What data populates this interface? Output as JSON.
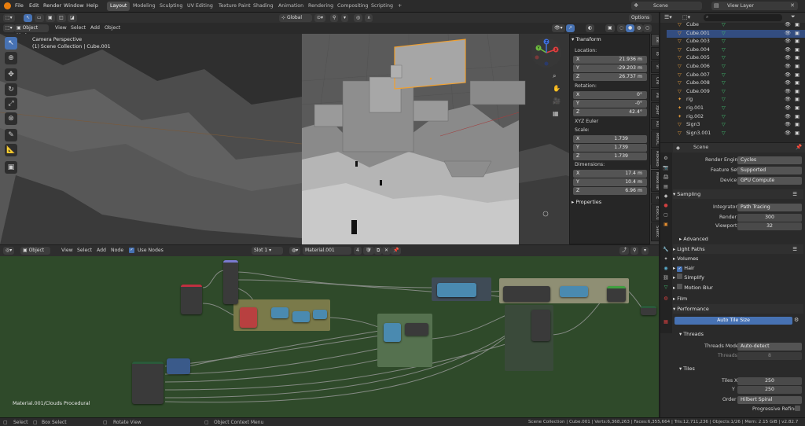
{
  "menus": [
    "File",
    "Edit",
    "Render",
    "Window",
    "Help"
  ],
  "workspaces": [
    "Layout",
    "Modeling",
    "Sculpting",
    "UV Editing",
    "Texture Paint",
    "Shading",
    "Animation",
    "Rendering",
    "Compositing",
    "Scripting"
  ],
  "active_workspace": "Layout",
  "add_tab": "+",
  "scene_name": "Scene",
  "view_layer": "View Layer",
  "viewport": {
    "mode": "Object Mode",
    "menus": [
      "View",
      "Select",
      "Add",
      "Object"
    ],
    "transform_orientation": "Global",
    "options": "Options",
    "overlay_line1": "Camera Perspective",
    "overlay_line2": "(1) Scene Collection | Cube.001"
  },
  "gizmo": {
    "x": "X",
    "y": "Y",
    "z": "Z"
  },
  "transform": {
    "title": "Transform",
    "location_label": "Location:",
    "location": [
      {
        "axis": "X",
        "value": "21.936 m"
      },
      {
        "axis": "Y",
        "value": "-29.203 m"
      },
      {
        "axis": "Z",
        "value": "26.737 m"
      }
    ],
    "rotation_label": "Rotation:",
    "rotation": [
      {
        "axis": "X",
        "value": "0°"
      },
      {
        "axis": "Y",
        "value": "-0°"
      },
      {
        "axis": "Z",
        "value": "42.4°"
      }
    ],
    "rotation_mode": "XYZ Euler",
    "scale_label": "Scale:",
    "scale": [
      {
        "axis": "X",
        "value": "1.739"
      },
      {
        "axis": "Y",
        "value": "1.739"
      },
      {
        "axis": "Z",
        "value": "1.739"
      }
    ],
    "dimensions_label": "Dimensions:",
    "dimensions": [
      {
        "axis": "X",
        "value": "17.4 m"
      },
      {
        "axis": "Y",
        "value": "10.4 m"
      },
      {
        "axis": "Z",
        "value": "6.96 m"
      }
    ],
    "properties": "Properties"
  },
  "side_tabs": [
    "Ite",
    "To",
    "Vi",
    "Cre",
    "Pa",
    "zper",
    "Ru",
    "MHXC",
    "Rokoko",
    "MakeTar",
    "E",
    "BoxCu",
    "Sketc"
  ],
  "outliner": [
    {
      "name": "Cube",
      "selected": false
    },
    {
      "name": "Cube.001",
      "selected": true
    },
    {
      "name": "Cube.003",
      "selected": false
    },
    {
      "name": "Cube.004",
      "selected": false
    },
    {
      "name": "Cube.005",
      "selected": false
    },
    {
      "name": "Cube.006",
      "selected": false
    },
    {
      "name": "Cube.007",
      "selected": false
    },
    {
      "name": "Cube.008",
      "selected": false
    },
    {
      "name": "Cube.009",
      "selected": false
    },
    {
      "name": "rig",
      "selected": false
    },
    {
      "name": "rig.001",
      "selected": false
    },
    {
      "name": "rig.002",
      "selected": false
    },
    {
      "name": "Sign3",
      "selected": false
    },
    {
      "name": "Sign3.001",
      "selected": false
    }
  ],
  "properties": {
    "scene": "Scene",
    "render_engine_label": "Render Engine",
    "render_engine": "Cycles",
    "feature_set_label": "Feature Set",
    "feature_set": "Supported",
    "device_label": "Device",
    "device": "GPU Compute",
    "sampling": "Sampling",
    "integrator_label": "Integrator",
    "integrator": "Path Tracing",
    "render_label": "Render",
    "render_samples": "300",
    "viewport_label": "Viewport",
    "viewport_samples": "32",
    "advanced": "Advanced",
    "light_paths": "Light Paths",
    "volumes": "Volumes",
    "hair": "Hair",
    "simplify": "Simplify",
    "motion_blur": "Motion Blur",
    "film": "Film",
    "performance": "Performance",
    "auto_tile_size": "Auto Tile Size",
    "threads": "Threads",
    "threads_mode_label": "Threads Mode",
    "threads_mode": "Auto-detect",
    "threads_label": "Threads",
    "threads_value": "8",
    "tiles": "Tiles",
    "tiles_x_label": "Tiles X",
    "tiles_x": "250",
    "tiles_y_label": "Y",
    "tiles_y": "250",
    "order_label": "Order",
    "order": "Hilbert Spiral",
    "progressive_refine": "Progressive Refine"
  },
  "node_editor": {
    "object_label": "Object",
    "menus": [
      "View",
      "Select",
      "Add",
      "Node"
    ],
    "use_nodes": "Use Nodes",
    "slot": "Slot 1",
    "material": "Material.001",
    "users": "4",
    "breadcrumb": "Material.001/Clouds Procedural"
  },
  "status": {
    "select": "Select",
    "box_select": "Box Select",
    "rotate_view": "Rotate View",
    "context_menu": "Object Context Menu",
    "info": "Scene Collection | Cube.001 | Verts:6,368,263 | Faces:6,355,664 | Tris:12,711,236 | Objects:1/26 | Mem: 2.15 GiB | v2.82.7"
  },
  "colors": {
    "accent": "#4772b3",
    "selection_orange": "#f0a030",
    "frame_green": "#55714f",
    "frame_olive": "#7a7a4a",
    "frame_khaki": "#8f8f74"
  }
}
